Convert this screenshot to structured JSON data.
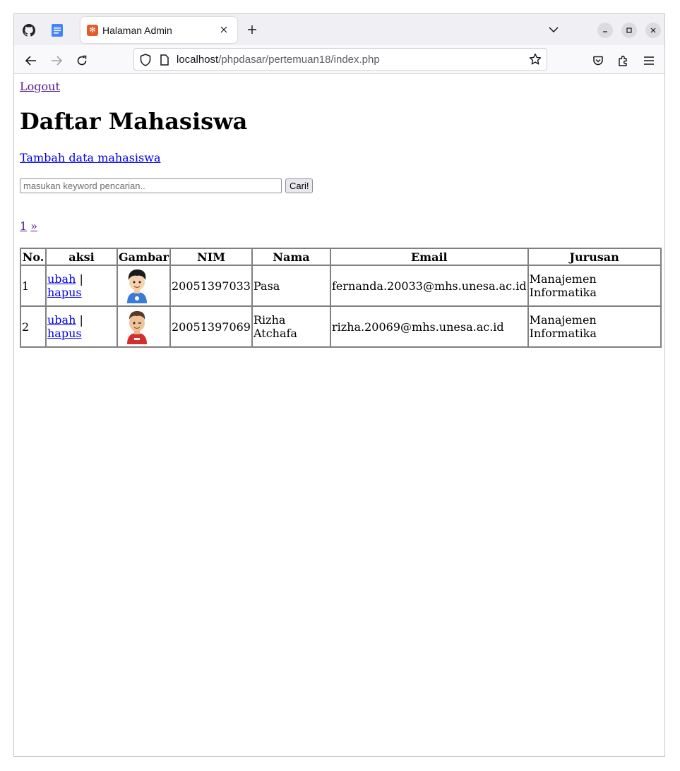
{
  "browser": {
    "tab_title": "Halaman Admin",
    "url_host": "localhost",
    "url_path": "/phpdasar/pertemuan18/index.php"
  },
  "page": {
    "logout": "Logout",
    "title": "Daftar Mahasiswa",
    "add_link": "Tambah data mahasiswa",
    "search": {
      "placeholder": "masukan keyword pencarian..",
      "value": "",
      "button": "Cari!"
    },
    "pagination": {
      "page": "1",
      "next": "»"
    },
    "table": {
      "headers": [
        "No.",
        "aksi",
        "Gambar",
        "NIM",
        "Nama",
        "Email",
        "Jurusan"
      ],
      "rows": [
        {
          "no": "1",
          "edit": "ubah",
          "sep": "|",
          "delete": "hapus",
          "nim": "20051397033",
          "nama": "Pasa",
          "email": "fernanda.20033@mhs.unesa.ac.id",
          "jurusan": "Manajemen Informatika",
          "avatar_color": "#3a7bd5"
        },
        {
          "no": "2",
          "edit": "ubah",
          "sep": "|",
          "delete": "hapus",
          "nim": "20051397069",
          "nama": "Rizha Atchafa",
          "email": "rizha.20069@mhs.unesa.ac.id",
          "jurusan": "Manajemen Informatika",
          "avatar_color": "#d32f2f"
        }
      ]
    }
  }
}
